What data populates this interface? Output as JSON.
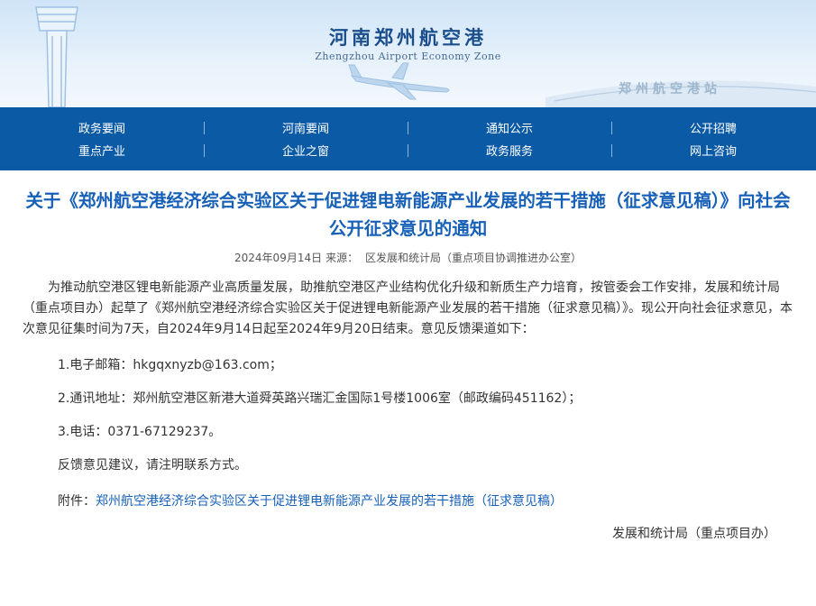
{
  "header": {
    "site_title": "河南郑州航空港",
    "site_subtitle": "Zhengzhou Airport Economy Zone",
    "station_text": "郑州航空港站"
  },
  "nav": {
    "row1": [
      "政务要闻",
      "河南要闻",
      "通知公示",
      "公开招聘"
    ],
    "row2": [
      "重点产业",
      "企业之窗",
      "政务服务",
      "网上咨询"
    ]
  },
  "article": {
    "title": "关于《郑州航空港经济综合实验区关于促进锂电新能源产业发展的若干措施（征求意见稿）》向社会公开征求意见的通知",
    "date": "2024年09月14日",
    "source_label": "来源：",
    "source": "区发展和统计局（重点项目协调推进办公室）",
    "intro": "为推动航空港区锂电新能源产业高质量发展，助推航空港区产业结构优化升级和新质生产力培育，按管委会工作安排，发展和统计局（重点项目办）起草了《郑州航空港经济综合实验区关于促进锂电新能源产业发展的若干措施（征求意见稿）》。现公开向社会征求意见，本次意见征集时间为7天，自2024年9月14日起至2024年9月20日结束。意见反馈渠道如下：",
    "item1": "1.电子邮箱：hkgqxnyzb@163.com；",
    "item2": "2.通讯地址：郑州航空港区新港大道舜英路兴瑞汇金国际1号楼1006室（邮政编码451162）；",
    "item3": "3.电话：0371-67129237。",
    "note": "反馈意见建议，请注明联系方式。",
    "attachment_label": "附件：",
    "attachment_link": "郑州航空港经济综合实验区关于促进锂电新能源产业发展的若干措施（征求意见稿）",
    "signature": "发展和统计局（重点项目办）"
  },
  "colors": {
    "nav_bg": "#0b5aa6",
    "title": "#1760b8",
    "link": "#1760b8"
  }
}
